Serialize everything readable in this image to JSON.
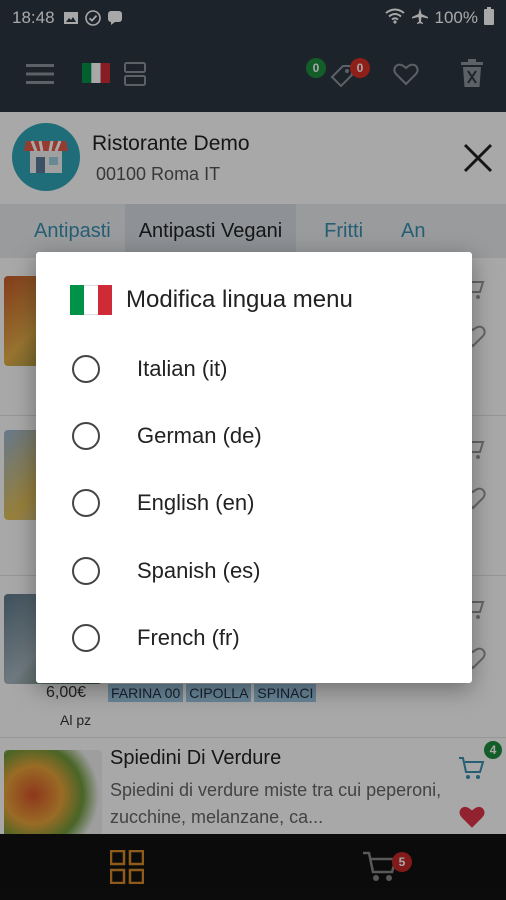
{
  "status_bar": {
    "time": "18:48",
    "battery": "100%"
  },
  "toolbar": {
    "flag_colors": [
      "#009246",
      "#ffffff",
      "#ce2b37"
    ],
    "tag_badge": "0",
    "compare_badge": "0",
    "colors": {
      "green_badge": "#1e8e3e",
      "red_badge": "#d93025"
    }
  },
  "store": {
    "name": "Ristorante Demo",
    "address": "00100 Roma IT"
  },
  "tabs": [
    {
      "label": "Antipasti"
    },
    {
      "label": "Antipasti Vegani",
      "active": true
    },
    {
      "label": "Fritti"
    },
    {
      "label": "An"
    }
  ],
  "items": [
    {},
    {},
    {
      "price": "6,00€",
      "unit": "Al pz",
      "tags": [
        "FARINA 00",
        "CIPOLLA",
        "SPINACI"
      ]
    },
    {
      "title": "Spiedini Di Verdure",
      "description": "Spiedini di verdure miste tra cui peperoni, zucchine, melanzane, ca...",
      "cart_badge": "4"
    }
  ],
  "bottom_bar": {
    "cart_badge": "5",
    "accent": "#d98b2a"
  },
  "dialog": {
    "title": "Modifica lingua menu",
    "options": [
      {
        "label": "Italian (it)"
      },
      {
        "label": "German (de)"
      },
      {
        "label": "English (en)"
      },
      {
        "label": "Spanish (es)"
      },
      {
        "label": "French (fr)"
      }
    ]
  }
}
